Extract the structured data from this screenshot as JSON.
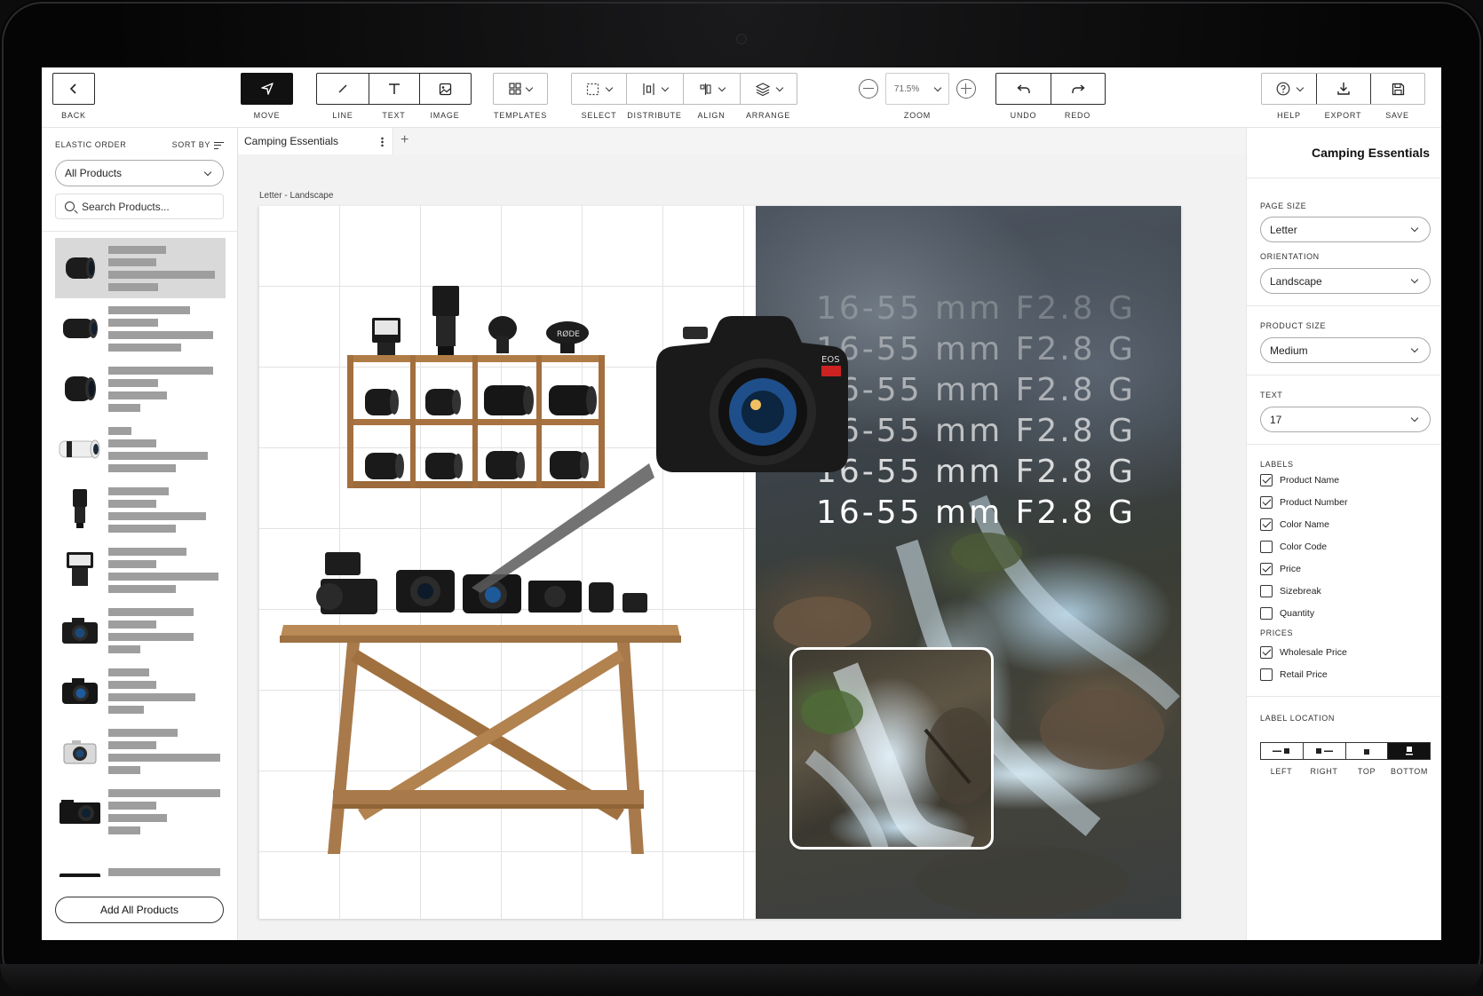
{
  "toolbar": {
    "back": "BACK",
    "move": "MOVE",
    "line": "LINE",
    "text": "TEXT",
    "image": "IMAGE",
    "templates": "TEMPLATES",
    "select": "SELECT",
    "distribute": "DISTRIBUTE",
    "align": "ALIGN",
    "arrange": "ARRANGE",
    "zoom": "ZOOM",
    "zoom_value": "71.5%",
    "undo": "UNDO",
    "redo": "REDO",
    "help": "HELP",
    "export": "EXPORT",
    "save": "SAVE"
  },
  "left_panel": {
    "elastic_order": "ELASTIC ORDER",
    "sort_by": "SORT BY",
    "filter_value": "All Products",
    "search_placeholder": "Search Products...",
    "add_all": "Add All Products"
  },
  "document": {
    "tab_name": "Camping Essentials",
    "tab_add": "+",
    "page_caption": "Letter - Landscape",
    "lens_text": [
      "16-55 mm F2.8 G",
      "16-55 mm F2.8 G",
      "16-55 mm F2.8 G",
      "16-55 mm F2.8 G",
      "16-55 mm F2.8 G",
      "16-55 mm F2.8 G"
    ]
  },
  "right_panel": {
    "title": "Camping Essentials",
    "page_size_label": "PAGE SIZE",
    "page_size": "Letter",
    "orientation_label": "ORIENTATION",
    "orientation": "Landscape",
    "product_size_label": "PRODUCT SIZE",
    "product_size": "Medium",
    "text_label": "TEXT",
    "text_size": "17",
    "labels_label": "LABELS",
    "labels": [
      {
        "name": "Product Name",
        "checked": true
      },
      {
        "name": "Product Number",
        "checked": true
      },
      {
        "name": "Color Name",
        "checked": true
      },
      {
        "name": "Color Code",
        "checked": false
      },
      {
        "name": "Price",
        "checked": true
      },
      {
        "name": "Sizebreak",
        "checked": false
      },
      {
        "name": "Quantity",
        "checked": false
      }
    ],
    "prices_label": "PRICES",
    "prices": [
      {
        "name": "Wholesale Price",
        "checked": true
      },
      {
        "name": "Retail Price",
        "checked": false
      }
    ],
    "label_location_label": "LABEL LOCATION",
    "label_locations": [
      "LEFT",
      "RIGHT",
      "TOP",
      "BOTTOM"
    ],
    "label_location_active": "BOTTOM"
  },
  "colors": {
    "accent": "#111111",
    "wood": "#a87a4a",
    "shelf": "#b07c45"
  }
}
